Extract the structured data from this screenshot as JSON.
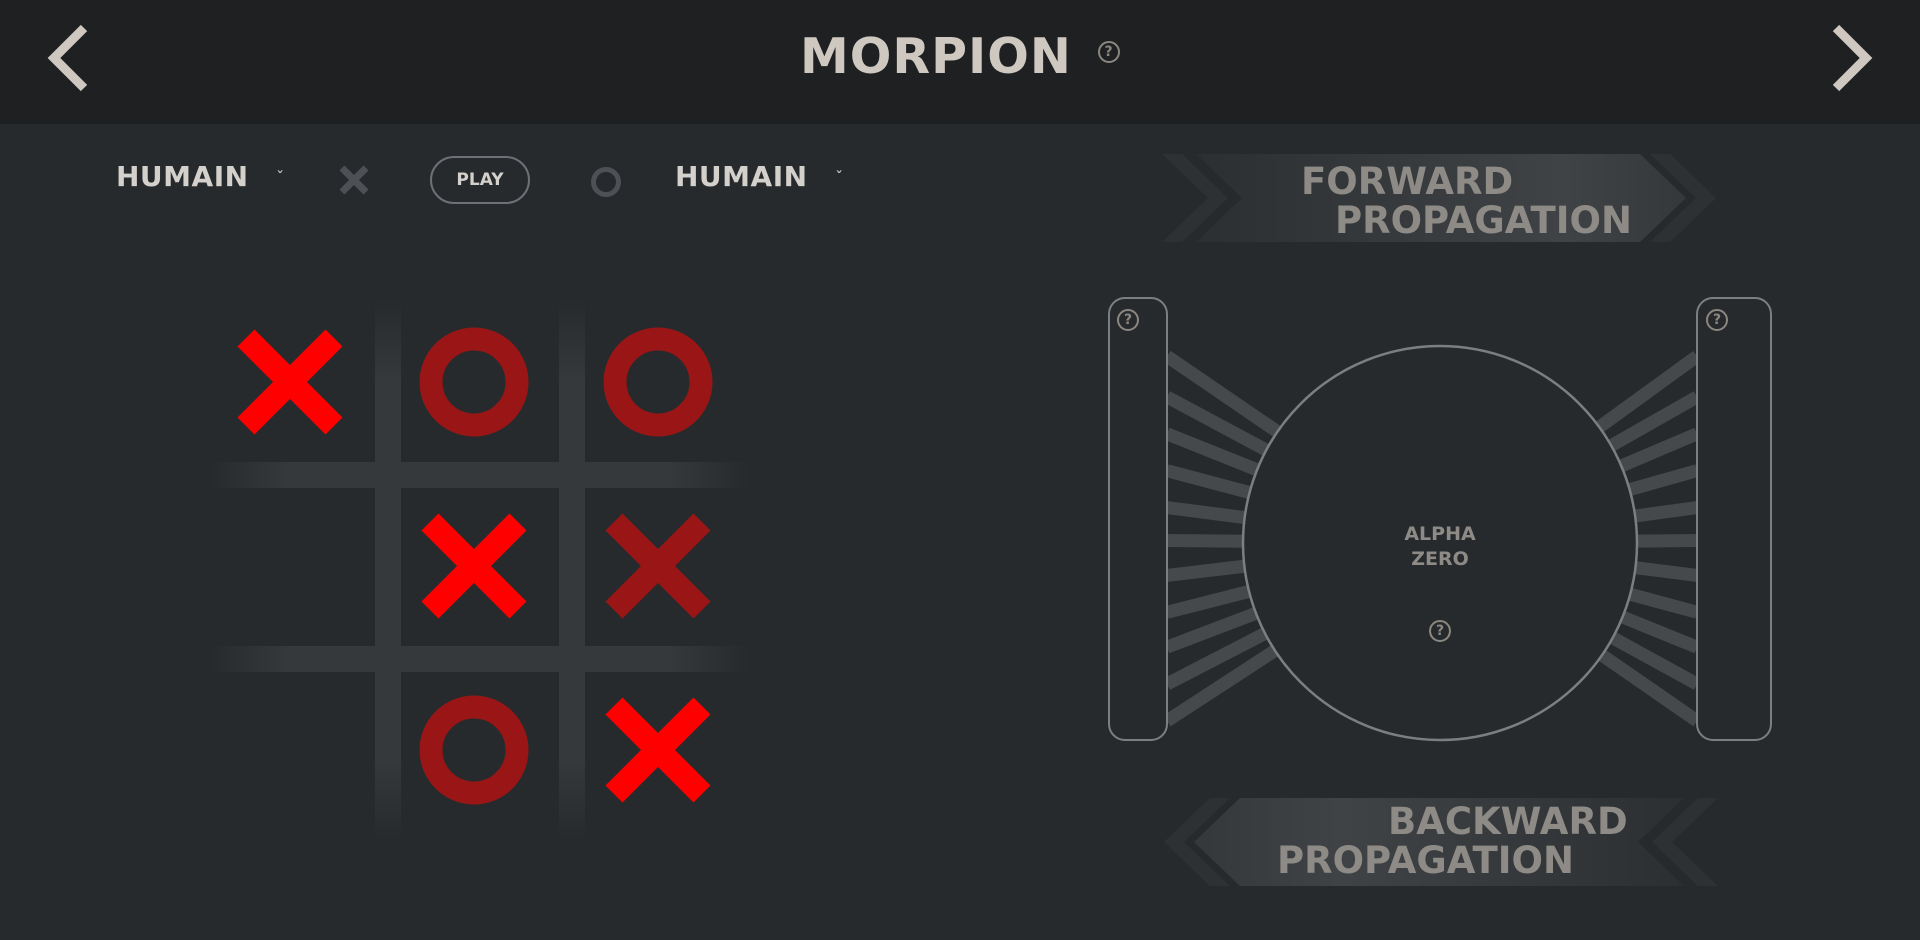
{
  "header": {
    "title": "MORPION",
    "help_symbol": "?",
    "prev_icon": "chevron-left-icon",
    "next_icon": "chevron-right-icon"
  },
  "controls": {
    "player1": {
      "label": "HUMAIN",
      "chevron": "ˇ",
      "symbol": "X"
    },
    "play_label": "PLAY",
    "player2": {
      "label": "HUMAIN",
      "chevron": "ˇ",
      "symbol": "O"
    }
  },
  "board": {
    "cells": [
      {
        "mark": "X",
        "color": "#ff0000"
      },
      {
        "mark": "O",
        "color": "#9a1515"
      },
      {
        "mark": "O",
        "color": "#9a1515"
      },
      {
        "mark": "",
        "color": ""
      },
      {
        "mark": "X",
        "color": "#ff0000"
      },
      {
        "mark": "X",
        "color": "#9a1515"
      },
      {
        "mark": "",
        "color": ""
      },
      {
        "mark": "O",
        "color": "#9a1515"
      },
      {
        "mark": "X",
        "color": "#ff0000"
      }
    ]
  },
  "network": {
    "forward_line1": "FORWARD",
    "forward_line2": "PROPAGATION",
    "backward_line1": "BACKWARD",
    "backward_line2": "PROPAGATION",
    "center_line1": "ALPHA",
    "center_line2": "ZERO",
    "help_symbol": "?"
  },
  "colors": {
    "background": "#272a2d",
    "header": "#1f2022",
    "x_bright": "#ff0000",
    "mark_dark": "#9a1515"
  }
}
